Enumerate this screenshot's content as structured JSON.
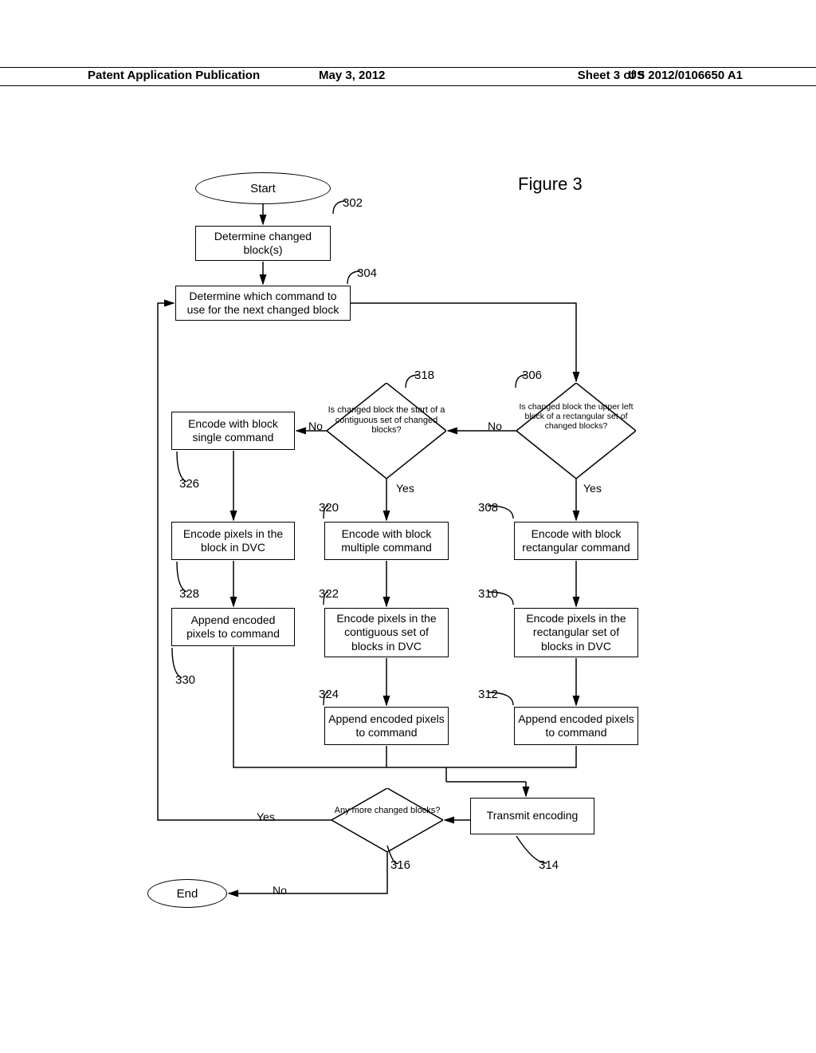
{
  "header": {
    "publication": "Patent Application Publication",
    "date": "May 3, 2012",
    "sheet": "Sheet 3 of 5",
    "number": "US 2012/0106650 A1"
  },
  "figure_title": "Figure 3",
  "nodes": {
    "start": "Start",
    "end": "End",
    "box302": "Determine changed block(s)",
    "box304": "Determine which command to use for the next changed block",
    "dia306": "Is changed block the upper left block of a rectangular set of changed blocks?",
    "box308": "Encode with block rectangular command",
    "box310": "Encode pixels in the rectangular set of blocks in DVC",
    "box312": "Append encoded pixels to command",
    "box314": "Transmit encoding",
    "dia316": "Any more changed blocks?",
    "dia318": "Is changed block the start of a contiguous set of changed blocks?",
    "box320": "Encode with block multiple command",
    "box322": "Encode pixels in the contiguous set of blocks in DVC",
    "box324": "Append encoded pixels to command",
    "box326": "Encode with block single command",
    "box328": "Encode pixels in the block in DVC",
    "box330": "Append encoded pixels to command"
  },
  "labels": {
    "n302": "302",
    "n304": "304",
    "n306": "306",
    "n308": "308",
    "n310": "310",
    "n312": "312",
    "n314": "314",
    "n316": "316",
    "n318": "318",
    "n320": "320",
    "n322": "322",
    "n324": "324",
    "n326": "326",
    "n328": "328",
    "n330": "330"
  },
  "edges": {
    "yes": "Yes",
    "no": "No"
  }
}
